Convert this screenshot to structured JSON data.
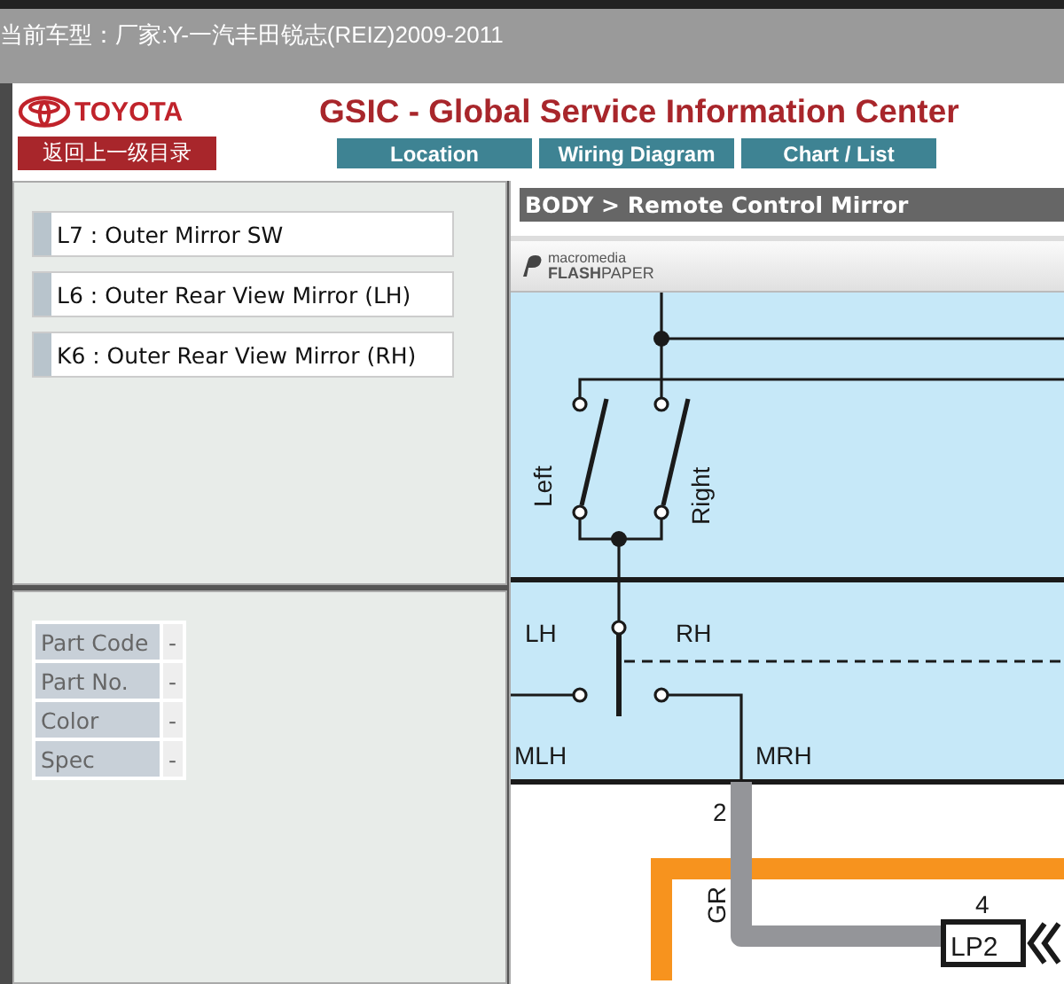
{
  "vehicle_label": "当前车型：厂家:Y-一汽丰田锐志(REIZ)2009-2011",
  "header": {
    "logo_text": "TOYOTA",
    "title": "GSIC - Global Service Information Center",
    "back_button": "返回上一级目录",
    "nav_buttons": [
      {
        "label": "Location"
      },
      {
        "label": "Wiring Diagram"
      },
      {
        "label": "Chart / List"
      }
    ]
  },
  "connectors": [
    {
      "label": "L7 : Outer Mirror SW"
    },
    {
      "label": "L6 : Outer Rear View Mirror (LH)"
    },
    {
      "label": "K6 : Outer Rear View Mirror (RH)"
    }
  ],
  "part_info": [
    {
      "label": "Part Code",
      "value": "-"
    },
    {
      "label": "Part No.",
      "value": "-"
    },
    {
      "label": "Color",
      "value": "-"
    },
    {
      "label": "Spec",
      "value": "-"
    }
  ],
  "breadcrumb": "BODY > Remote Control Mirror",
  "viewer": {
    "brand_top": "macromedia",
    "brand_bottom": "**FLASH**PAPER"
  },
  "diagram": {
    "left": "Left",
    "right": "Right",
    "lh": "LH",
    "rh": "RH",
    "mlh": "MLH",
    "mrh": "MRH",
    "pin_2": "2",
    "wire_color": "GR",
    "pin_4": "4",
    "connector": "LP2"
  }
}
